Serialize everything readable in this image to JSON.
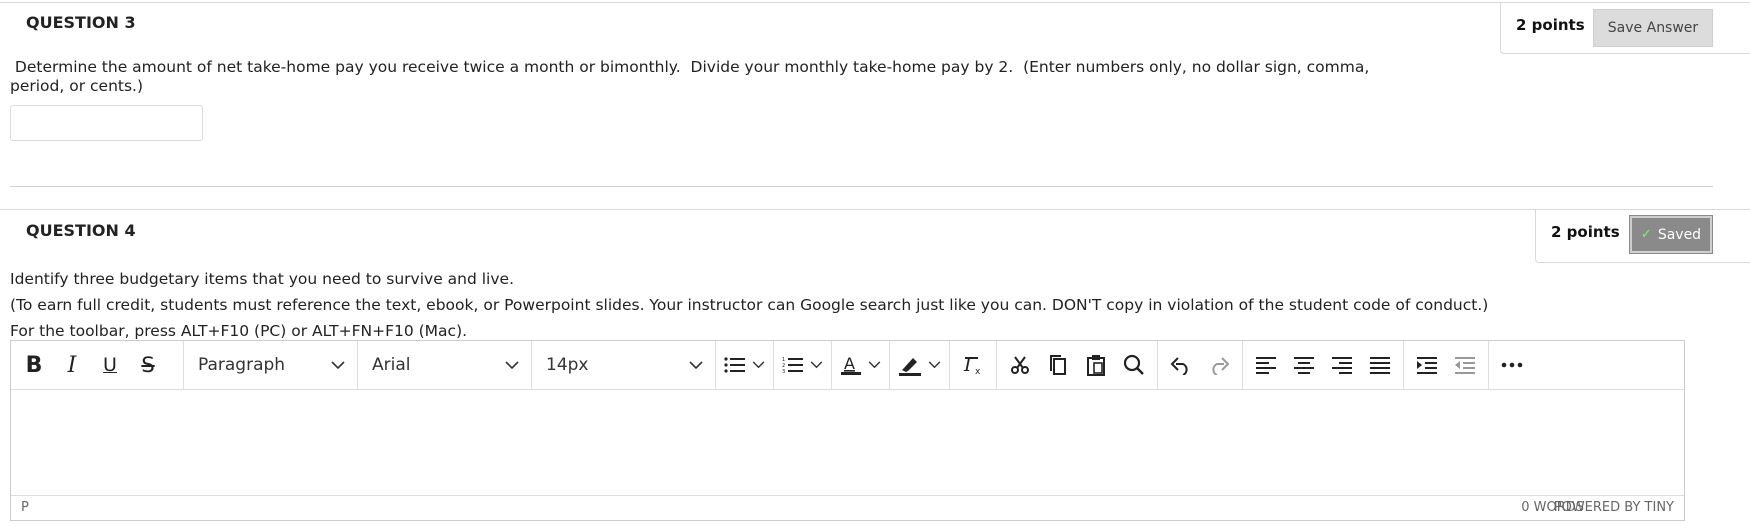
{
  "question3": {
    "title": "QUESTION 3",
    "points": "2 points",
    "save_label": "Save Answer",
    "text_line1": " Determine the amount of net take-home pay you receive twice a month or bimonthly.  Divide your monthly take-home pay by 2.  (Enter numbers only, no dollar sign, comma,",
    "text_line2": "period, or cents.)",
    "answer_value": ""
  },
  "question4": {
    "title": "QUESTION 4",
    "points": "2 points",
    "saved_label": "Saved",
    "text_line1": "Identify three budgetary items that you need to survive and live.",
    "text_line2": "(To earn full credit, students must reference the text, ebook, or Powerpoint slides. Your instructor can Google search just like you can. DON'T copy in violation of the student code of conduct.)",
    "toolbar_hint": "For the toolbar, press ALT+F10 (PC) or ALT+FN+F10 (Mac)."
  },
  "editor": {
    "block_format": "Paragraph",
    "font_family": "Arial",
    "font_size": "14px",
    "path": "P",
    "word_count": "0 WORDS",
    "powered_by": "POWERED BY TINY",
    "icons": [
      "bold-icon",
      "italic-icon",
      "underline-icon",
      "strikethrough-icon",
      "bullet-list-icon",
      "numbered-list-icon",
      "text-color-icon",
      "highlight-icon",
      "clear-formatting-icon",
      "cut-icon",
      "copy-icon",
      "paste-icon",
      "search-icon",
      "undo-icon",
      "redo-icon",
      "align-left-icon",
      "align-center-icon",
      "align-right-icon",
      "justify-icon",
      "indent-icon",
      "outdent-icon",
      "more-icon"
    ]
  }
}
